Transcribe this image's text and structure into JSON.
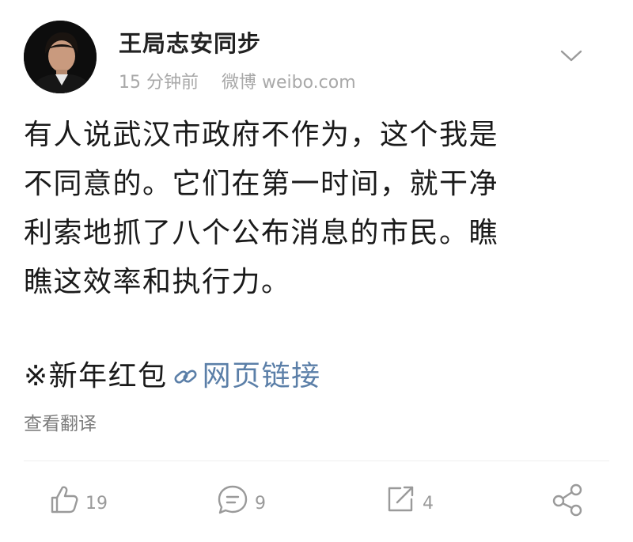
{
  "post": {
    "username": "王局志安同步",
    "time": "15 分钟前",
    "source": "微博 weibo.com",
    "lines": [
      "有人说武汉市政府不作为，这个我是",
      "不同意的。它们在第一时间，就干净",
      "利索地抓了八个公布消息的市民。瞧",
      "瞧这效率和执行力。"
    ],
    "extra_text": "※新年红包",
    "link_label": "网页链接",
    "translate_label": "查看翻译"
  },
  "actions": {
    "likes": "19",
    "comments": "9",
    "reposts": "4"
  },
  "icons": {
    "dropdown": "chevron-down-icon",
    "link": "link-icon",
    "like": "thumbs-up-icon",
    "comment": "comment-icon",
    "repost": "repost-icon",
    "share": "share-icon"
  },
  "colors": {
    "link": "#5b7fa8",
    "meta": "#a8a8a8",
    "icon": "#9a9a9a"
  }
}
